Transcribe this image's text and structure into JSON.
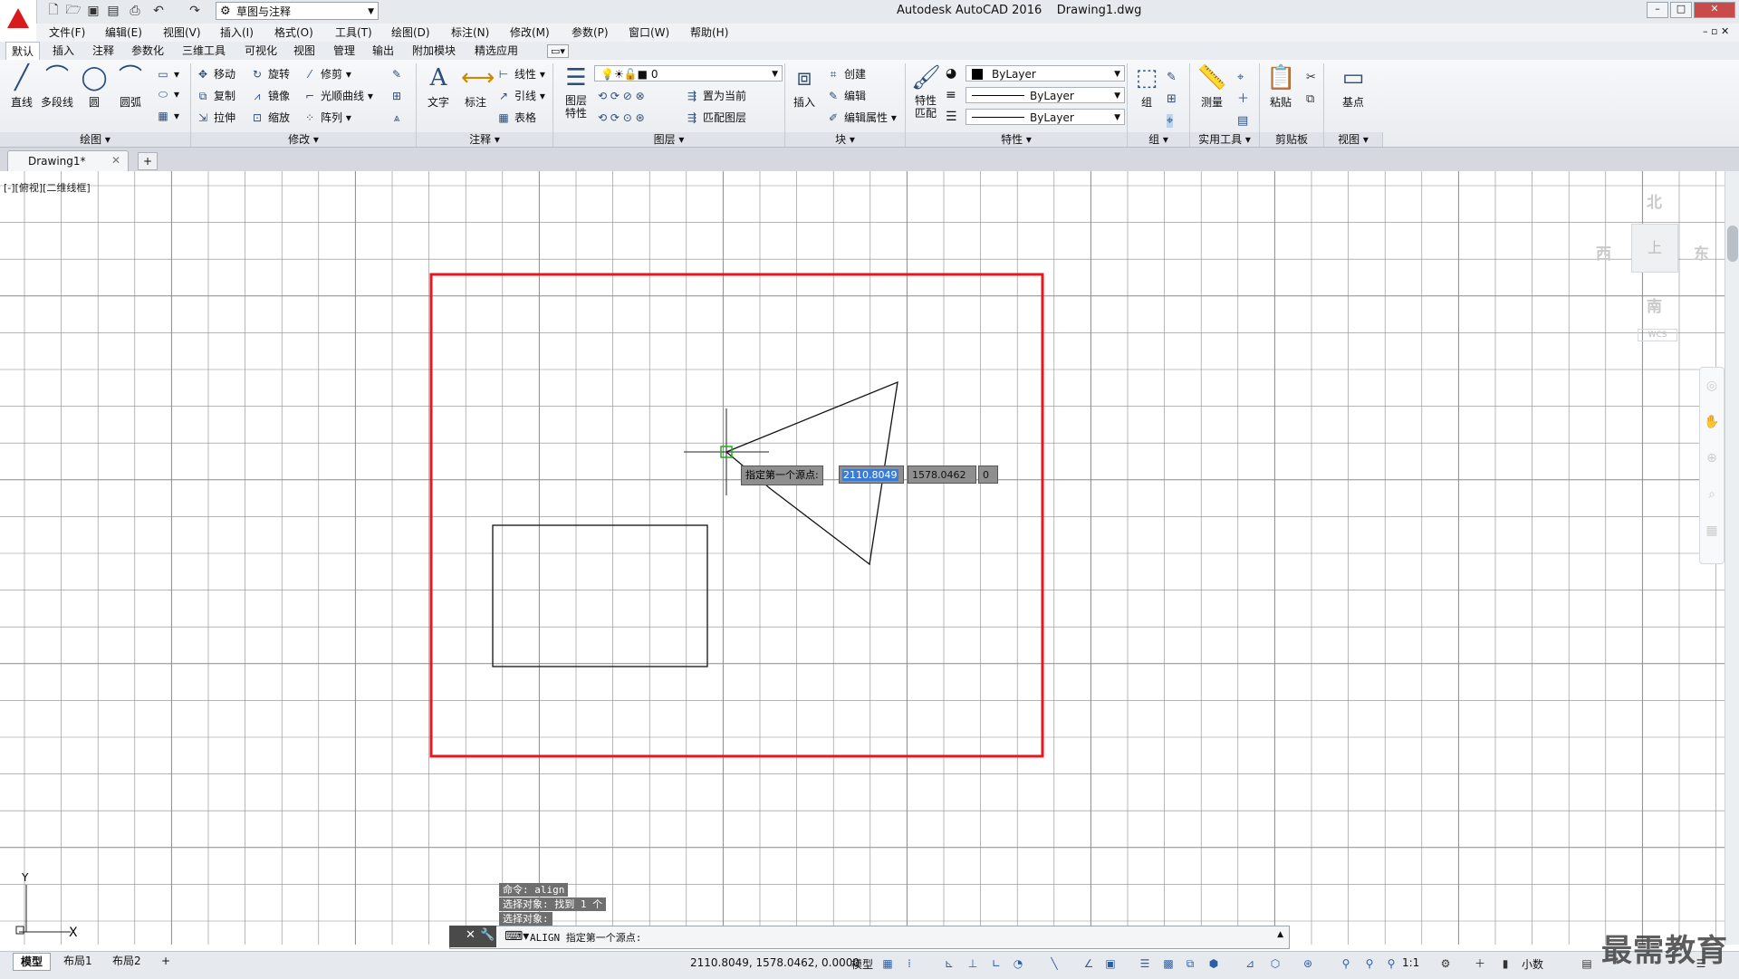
{
  "title": {
    "app": "Autodesk AutoCAD 2016",
    "file": "Drawing1.dwg"
  },
  "quick_access": {
    "workspace": "草图与注释"
  },
  "menu": [
    "文件(F)",
    "编辑(E)",
    "视图(V)",
    "插入(I)",
    "格式(O)",
    "工具(T)",
    "绘图(D)",
    "标注(N)",
    "修改(M)",
    "参数(P)",
    "窗口(W)",
    "帮助(H)"
  ],
  "ribbon_tabs": [
    "默认",
    "插入",
    "注释",
    "参数化",
    "三维工具",
    "可视化",
    "视图",
    "管理",
    "输出",
    "附加模块",
    "精选应用"
  ],
  "ribbon": {
    "draw": {
      "title": "绘图",
      "line": "直线",
      "polyline": "多段线",
      "circle": "圆",
      "arc": "圆弧"
    },
    "modify": {
      "title": "修改",
      "move": "移动",
      "rotate": "旋转",
      "trim": "修剪",
      "copy": "复制",
      "mirror": "镜像",
      "fillet": "光顺曲线",
      "stretch": "拉伸",
      "scale": "缩放",
      "array": "阵列"
    },
    "annotation": {
      "title": "注释",
      "text": "文字",
      "dimension": "标注",
      "linear": "线性",
      "leader": "引线",
      "table": "表格"
    },
    "layers": {
      "title": "图层",
      "props": "图层\n特性",
      "current_layer": "0",
      "set_current": "置为当前",
      "match_layer": "匹配图层"
    },
    "block": {
      "title": "块",
      "insert": "插入",
      "create": "创建",
      "edit": "编辑",
      "edit_attr": "编辑属性"
    },
    "properties": {
      "title": "特性",
      "match": "特性\n匹配",
      "color": "ByLayer",
      "linetype": "ByLayer",
      "lineweight": "ByLayer"
    },
    "groups": {
      "title": "组",
      "group": "组"
    },
    "utilities": {
      "title": "实用工具",
      "measure": "测量"
    },
    "clipboard": {
      "title": "剪贴板",
      "paste": "粘贴"
    },
    "view": {
      "title": "视图",
      "base": "基点"
    }
  },
  "doc_tab": {
    "name": "Drawing1*"
  },
  "viewport_label": "[-][俯视][二维线框]",
  "viewcube": {
    "north": "北",
    "south": "南",
    "east": "东",
    "west": "西",
    "top": "上",
    "wcs": "WCS"
  },
  "dynamic_input": {
    "prompt": "指定第一个源点:",
    "x": "2110.8049",
    "y": "1578.0462",
    "z": "0"
  },
  "command_history": [
    "命令:  align",
    "选择对象: 找到 1 个",
    "选择对象:"
  ],
  "command_line": "ALIGN 指定第一个源点:",
  "layout_tabs": [
    "模型",
    "布局1",
    "布局2"
  ],
  "status": {
    "coords": "2110.8049, 1578.0462, 0.0000",
    "space": "模型",
    "scale": "1:1",
    "units": "小数"
  },
  "watermark": "最需教育",
  "colors": {
    "accent_red": "#e8171d",
    "selection_blue": "#3a7bd5",
    "grid": "#8a8a8a"
  }
}
